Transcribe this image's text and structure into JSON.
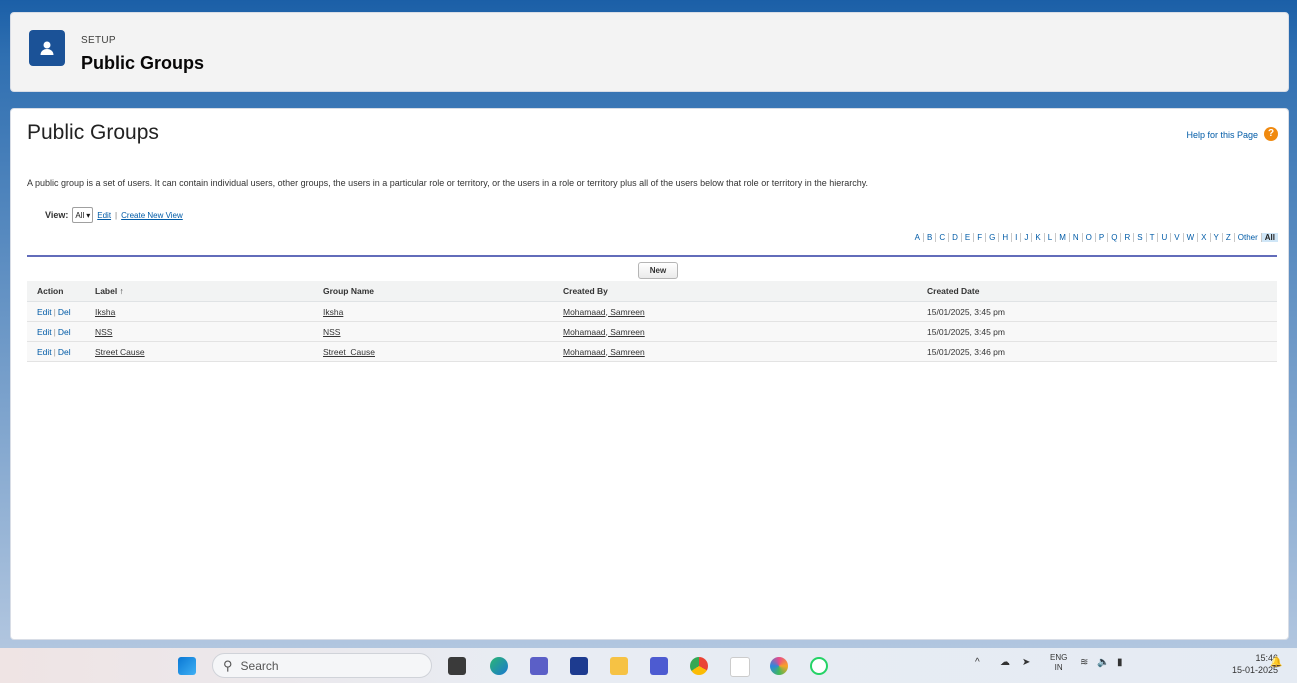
{
  "header": {
    "eyebrow": "SETUP",
    "title": "Public Groups"
  },
  "page": {
    "title": "Public Groups",
    "help_link": "Help for this Page",
    "description": "A public group is a set of users. It can contain individual users, other groups, the users in a particular role or territory, or the users in a role or territory plus all of the users below that role or territory in the hierarchy."
  },
  "view": {
    "label": "View:",
    "selected": "All",
    "edit": "Edit",
    "create": "Create New View"
  },
  "alphabet": [
    "A",
    "B",
    "C",
    "D",
    "E",
    "F",
    "G",
    "H",
    "I",
    "J",
    "K",
    "L",
    "M",
    "N",
    "O",
    "P",
    "Q",
    "R",
    "S",
    "T",
    "U",
    "V",
    "W",
    "X",
    "Y",
    "Z",
    "Other",
    "All"
  ],
  "new_button": "New",
  "table": {
    "headers": [
      "Action",
      "Label ↑",
      "Group Name",
      "Created By",
      "Created Date"
    ],
    "rows": [
      {
        "edit": "Edit",
        "del": "Del",
        "label": "Iksha",
        "group_name": "Iksha",
        "created_by": "Mohamaad, Samreen",
        "created_date": "15/01/2025, 3:45 pm"
      },
      {
        "edit": "Edit",
        "del": "Del",
        "label": "NSS",
        "group_name": "NSS",
        "created_by": "Mohamaad, Samreen",
        "created_date": "15/01/2025, 3:45 pm"
      },
      {
        "edit": "Edit",
        "del": "Del",
        "label": "Street Cause",
        "group_name": "Street_Cause",
        "created_by": "Mohamaad, Samreen",
        "created_date": "15/01/2025, 3:46 pm"
      }
    ]
  },
  "taskbar": {
    "search_placeholder": "Search",
    "lang_top": "ENG",
    "lang_bottom": "IN",
    "time": "15:46",
    "date": "15-01-2025"
  },
  "colors": {
    "brand": "#1b5297",
    "link": "#015ba7",
    "help": "#f08a10"
  }
}
